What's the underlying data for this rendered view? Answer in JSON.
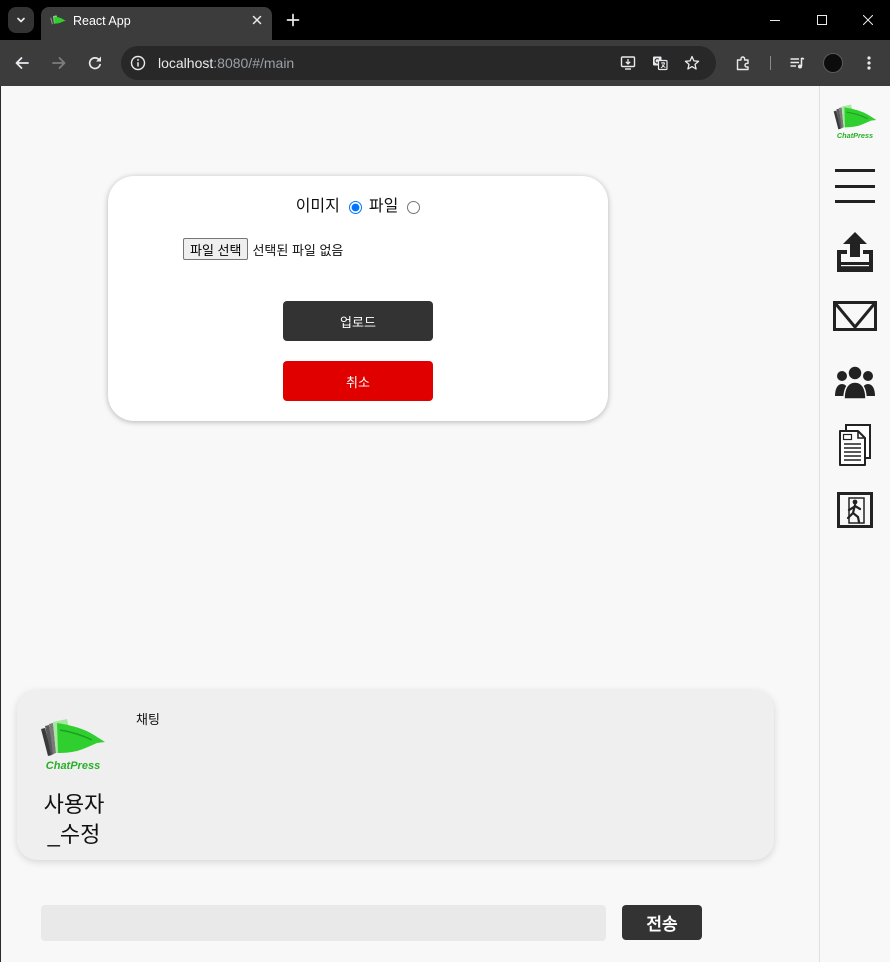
{
  "browser": {
    "tab_title": "React App",
    "url_host": "localhost",
    "url_path": ":8080/#/main",
    "icons": {
      "tab_search": "chevron-down-icon",
      "favicon": "chatpress-logo-icon",
      "tab_close": "close-icon",
      "new_tab": "plus-icon",
      "minimize": "minimize-icon",
      "maximize": "maximize-icon",
      "close_window": "close-window-icon",
      "back": "arrow-left-icon",
      "forward": "arrow-right-icon",
      "reload": "reload-icon",
      "site_info": "info-icon",
      "install": "install-app-icon",
      "translate": "translate-icon",
      "bookmark": "star-icon",
      "extensions": "puzzle-icon",
      "media": "media-control-icon",
      "profile": "profile-avatar",
      "menu": "more-vertical-icon"
    }
  },
  "sidebar": {
    "logo_text": "ChatPress",
    "items": [
      {
        "icon": "menu-icon"
      },
      {
        "icon": "upload-icon"
      },
      {
        "icon": "mail-icon"
      },
      {
        "icon": "users-icon"
      },
      {
        "icon": "document-icon"
      },
      {
        "icon": "exit-icon"
      }
    ]
  },
  "upload_modal": {
    "options": [
      {
        "label": "이미지",
        "checked": true
      },
      {
        "label": "파일",
        "checked": false
      }
    ],
    "file_button_label": "파일 선택",
    "file_status": "선택된 파일 없음",
    "upload_label": "업로드",
    "cancel_label": "취소"
  },
  "chat": {
    "logo_text": "ChatPress",
    "title": "채팅",
    "user_name": "사용자_수정"
  },
  "composer": {
    "input_value": "",
    "send_label": "전송"
  },
  "colors": {
    "dark_button": "#333333",
    "cancel_button": "#e00000",
    "brand_green": "#2fcf2f",
    "brand_green_text": "#27b027",
    "page_background": "#f8f8f8",
    "radio_accent": "#0075ff"
  }
}
